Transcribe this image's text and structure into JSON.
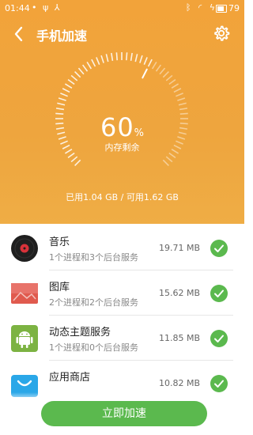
{
  "status_bar": {
    "time": "01:44",
    "left_icons": [
      "notification-dot",
      "usb-icon",
      "usb-debug-icon"
    ],
    "right_icons": [
      "bluetooth-icon",
      "wifi-icon",
      "charging-icon"
    ],
    "battery": "79"
  },
  "titlebar": {
    "title": "手机加速",
    "back_icon": "back-arrow-icon",
    "settings_icon": "gear-icon"
  },
  "memory": {
    "percent": "60",
    "percent_unit": "%",
    "percent_fraction": 0.6,
    "label": "内存剩余",
    "summary": "已用1.04 GB / 可用1.62 GB"
  },
  "apps": [
    {
      "name": "音乐",
      "desc": "1个进程和3个后台服务",
      "size": "19.71 MB",
      "icon": "music-disc-icon",
      "checked": true
    },
    {
      "name": "图库",
      "desc": "2个进程和2个后台服务",
      "size": "15.62 MB",
      "icon": "gallery-icon",
      "checked": true
    },
    {
      "name": "动态主题服务",
      "desc": "1个进程和0个后台服务",
      "size": "11.85 MB",
      "icon": "android-robot-icon",
      "checked": true
    },
    {
      "name": "应用商店",
      "desc": "",
      "size": "10.82 MB",
      "icon": "app-store-icon",
      "checked": true
    }
  ],
  "bottom_button": {
    "label": "立即加速"
  },
  "colors": {
    "header": "#f2a33a",
    "accent": "#5bb94e",
    "check": "#5bb94e"
  }
}
